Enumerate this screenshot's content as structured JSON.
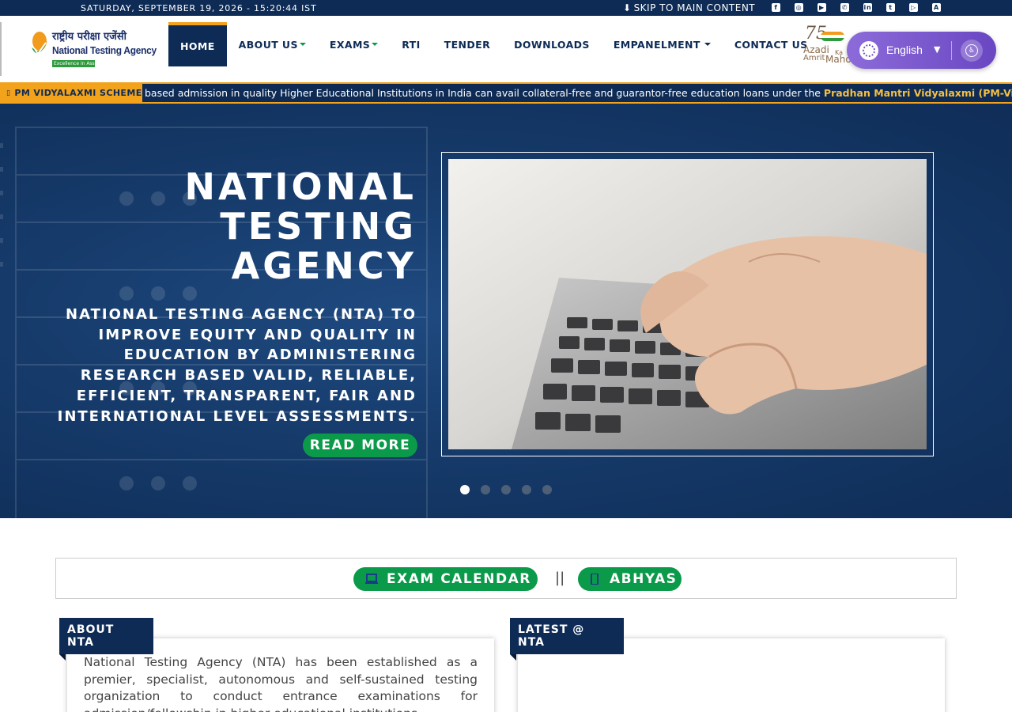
{
  "topbar": {
    "datetime": "SATURDAY, SEPTEMBER 19, 2026 - 15:20:44 IST",
    "skip_label": "SKIP TO MAIN CONTENT",
    "socials": [
      "facebook-icon",
      "instagram-icon",
      "youtube-icon",
      "whatsapp-icon",
      "linkedin-icon",
      "twitter-icon",
      "google-play-icon",
      "app-store-icon"
    ]
  },
  "logo": {
    "hindi": "राष्ट्रीय परीक्षा एजेंसी",
    "english": "National Testing Agency",
    "tagline": "Excellence in Assessment"
  },
  "nav": {
    "items": [
      {
        "label": "HOME",
        "active": true,
        "dropdown": false
      },
      {
        "label": "ABOUT US",
        "active": false,
        "dropdown": true
      },
      {
        "label": "EXAMS",
        "active": false,
        "dropdown": true
      },
      {
        "label": "RTI",
        "active": false,
        "dropdown": false
      },
      {
        "label": "TENDER",
        "active": false,
        "dropdown": false
      },
      {
        "label": "DOWNLOADS",
        "active": false,
        "dropdown": false
      },
      {
        "label": "EMPANELMENT",
        "active": false,
        "dropdown": true
      },
      {
        "label": "CONTACT US",
        "active": false,
        "dropdown": false
      }
    ]
  },
  "azadi": {
    "num": "75",
    "line1": "Azadi",
    "line2": "Ka",
    "line3": "Amrit",
    "line4": "Mahotsav"
  },
  "language": {
    "selected": "English",
    "arrow": "▼"
  },
  "ticker": {
    "tag": "PM VIDYALAXMI SCHEME",
    "message": "based admission in quality Higher Educational Institutions in India can avail collateral-free and guarantor-free education loans under the ",
    "highlight": "Pradhan Mantri Vidyalaxmi (PM-Vidyalaxmi)"
  },
  "hero": {
    "title_line1": "NATIONAL",
    "title_line2": "TESTING",
    "title_line3": "AGENCY",
    "subtitle": "NATIONAL TESTING AGENCY (NTA) TO IMPROVE EQUITY AND QUALITY IN EDUCATION BY ADMINISTERING RESEARCH BASED VALID, RELIABLE, EFFICIENT, TRANSPARENT, FAIR AND INTERNATIONAL LEVEL ASSESSMENTS.",
    "read_more": "READ MORE",
    "slides": 5,
    "active_slide": 1
  },
  "quicklinks": {
    "exam_calendar": "EXAM CALENDAR",
    "separator": "||",
    "abhyas": "ABHYAS"
  },
  "about": {
    "heading": "ABOUT NTA",
    "text": "National Testing Agency (NTA) has been established as a premier, specialist, autonomous and self-sustained testing organization to conduct entrance examinations for admission/fellowship in higher educational institutions."
  },
  "latest": {
    "heading": "LATEST @ NTA"
  },
  "colors": {
    "navy": "#0d2b55",
    "orange": "#f2a21b",
    "green": "#0a9a4a",
    "purple": "#7a52cc"
  }
}
